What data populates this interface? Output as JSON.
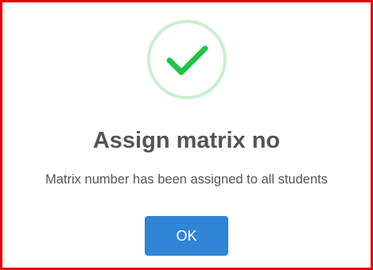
{
  "dialog": {
    "icon": "check-icon",
    "title": "Assign matrix no",
    "message": "Matrix number has been assigned to all students",
    "ok_label": "OK"
  },
  "colors": {
    "border": "#e50000",
    "success_ring": "#c9f0cd",
    "check": "#1fc447",
    "title_text": "#545454",
    "button": "#3085d6"
  }
}
